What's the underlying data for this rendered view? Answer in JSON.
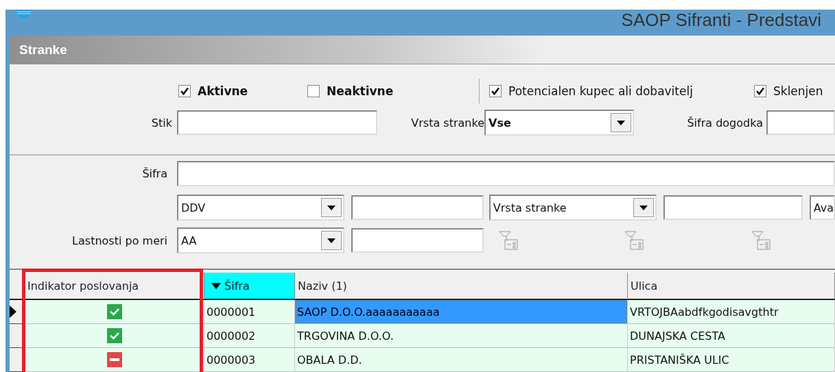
{
  "window": {
    "title": "SAOP Sifranti - Predstavi"
  },
  "panel": {
    "title": "Stranke"
  },
  "filters": {
    "checkboxes": [
      {
        "label": "Aktivne",
        "checked": true,
        "bold": true
      },
      {
        "label": "Neaktivne",
        "checked": false,
        "bold": true
      },
      {
        "label": "Potencialen kupec ali dobavitelj",
        "checked": true,
        "bold": false
      },
      {
        "label": "Sklenjen",
        "checked": true,
        "bold": false
      }
    ],
    "stik": {
      "label": "Stik"
    },
    "vrsta_stranke": {
      "label": "Vrsta stranke",
      "value": "Vse"
    },
    "sifra_dogodka": {
      "label": "Šifra dogodka"
    }
  },
  "search": {
    "sifra": {
      "label": "Šifra"
    },
    "property_rows": [
      {
        "label": "",
        "combo_1": "DDV",
        "combo_2": "Vrsta stranke",
        "combo_3": "Ava"
      },
      {
        "label": "Lastnosti po meri",
        "combo_1": "AA"
      }
    ]
  },
  "table": {
    "columns": [
      {
        "label": "Indikator poslovanja",
        "sorted": false,
        "highlighted": true
      },
      {
        "label": "Šifra",
        "sorted": true,
        "highlighted": false
      },
      {
        "label": "Naziv (1)",
        "sorted": false,
        "highlighted": false
      },
      {
        "label": "Ulica",
        "sorted": false,
        "highlighted": false
      }
    ],
    "rows": [
      {
        "kind": "check",
        "sifra": "0000001",
        "naziv": "SAOP D.O.O.aaaaaaaaaaa",
        "ulica": "VRTOJBAabdfkgodisavgthtr",
        "selected": true
      },
      {
        "kind": "check",
        "sifra": "0000002",
        "naziv": "TRGOVINA D.O.O.",
        "ulica": "DUNAJSKA CESTA",
        "selected": false
      },
      {
        "kind": "minus",
        "sifra": "0000003",
        "naziv": "OBALA D.D.",
        "ulica": "PRISTANIŠKA ULIC",
        "selected": false
      }
    ]
  }
}
